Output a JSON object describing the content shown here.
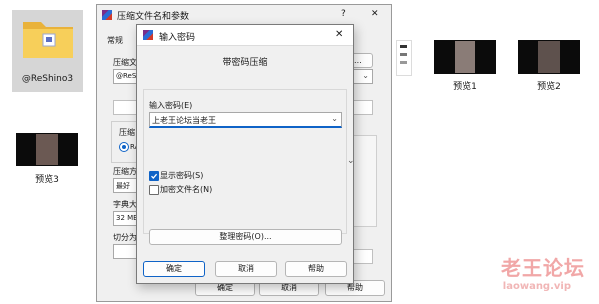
{
  "desktop": {
    "folder_label": "@ReShino3",
    "previews": [
      "预览1",
      "预览2",
      "预览3"
    ]
  },
  "main_window": {
    "title": "压缩文件名和参数",
    "title_help": "?",
    "title_close": "✕",
    "tab_general": "常规",
    "archive_name_label": "压缩文",
    "archive_name_value": "@ReSh",
    "browse_button": "(B)...",
    "format_label": "压缩",
    "format_option_rar": "RA",
    "method_label": "压缩方",
    "method_value": "最好",
    "dict_label": "字典大",
    "dict_value": "32 MB",
    "split_label": "切分为",
    "ok_button": "确定",
    "cancel_button": "取消",
    "help_button": "帮助"
  },
  "password_dialog": {
    "title": "输入密码",
    "close": "✕",
    "heading": "带密码压缩",
    "enter_label": "输入密码(E)",
    "password_value": "上老王论坛当老王",
    "show_password_label": "显示密码(S)",
    "show_password_checked": true,
    "encrypt_names_label": "加密文件名(N)",
    "encrypt_names_checked": false,
    "organize_button": "整理密码(O)...",
    "ok_button": "确定",
    "cancel_button": "取消",
    "help_button": "帮助"
  },
  "watermark": {
    "brand": "老王论坛",
    "site": "laowang.vip"
  },
  "colors": {
    "accent": "#0f63c7",
    "folder": "#f5c84c",
    "watermark": "#f1a7a7"
  }
}
